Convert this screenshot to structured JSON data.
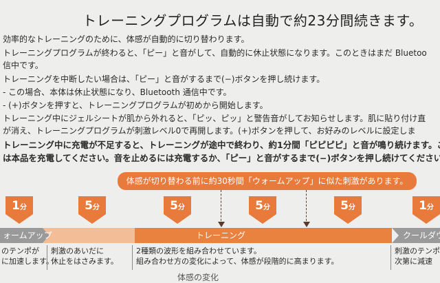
{
  "title": "トレーニングプログラムは自動で約23分間続きます。",
  "paragraphs": [
    "効率的なトレーニングのために、体感が自動的に切り替わります。",
    "トレーニングプログラムが終わると、「ピー」と音がして、自動的に休止状態になります。このときはまだ Bluetoo",
    "信中です。",
    "トレーニングを中断したい場合は、「ピー」と音がするまで(−)ボタンを押し続けます。",
    "-  この場合、本体は休止状態になり、Bluetooth 通信中です。",
    "-  (+)ボタンを押すと、トレーニングプログラムが初めから開始します。",
    "トレーニング中にジェルシートが肌から外れると、「ピッ、ピッ」と警告音がしてお知らせします。肌に貼り付け直",
    "が消え、トレーニングプログラムが刺激レベル0で再開します。(+)ボタンを押して、お好みのレベルに設定しま",
    "トレーニング中に充電が不足すると、トレーニングが途中で終わり、約1分間「ピピピピ」と音が鳴り続けます。こ",
    "は本品を充電してください。音を止めるには充電するか、「ピー」と音がするまで(−)ボタンを押し続けてください"
  ],
  "banner": "体感が切り替わる前に約30秒間「ウォームアップ」に似た刺激があります。",
  "durations": [
    {
      "value": "1",
      "unit": "分"
    },
    {
      "value": "5",
      "unit": "分"
    },
    {
      "value": "5",
      "unit": "分"
    },
    {
      "value": "5",
      "unit": "分"
    },
    {
      "value": "5",
      "unit": "分"
    },
    {
      "value": "1",
      "unit": "分"
    }
  ],
  "phases": {
    "warmup": "ォームアップ",
    "training": "トレーニング",
    "cooldown": "クールダウ"
  },
  "descriptions": {
    "warmup": [
      "のテンポが",
      "に加速します。"
    ],
    "training_a": [
      "刺激のあいだに",
      "休止をはさみます。"
    ],
    "training_b": [
      "2種類の波形を組み合わせています。",
      "組み合わせ方の変化によって、体感が段階的に高まります。"
    ],
    "cooldown": [
      "刺激のテンポ",
      "次第に減速"
    ]
  },
  "footer": "体感の変化",
  "colors": {
    "orange": "#e87a3c",
    "bar_light": "#f3bd98",
    "bar_dark": "#e9813f",
    "bar_gray": "#9a9a9a"
  }
}
